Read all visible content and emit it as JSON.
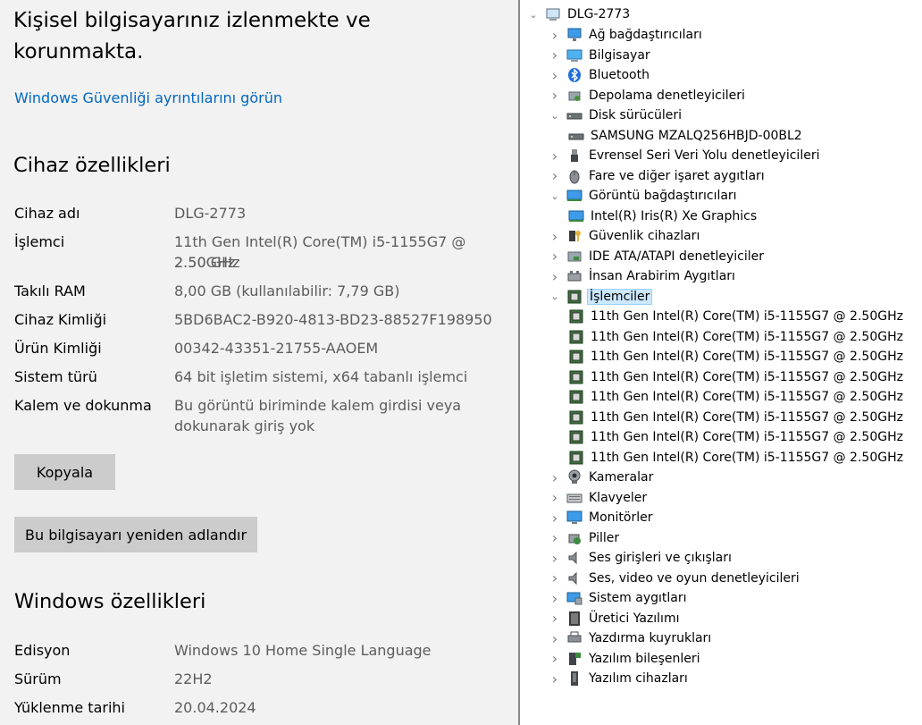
{
  "about": {
    "header": "Kişisel bilgisayarınız izlenmekte ve korunmakta.",
    "security_link": "Windows Güvenliği ayrıntılarını görün",
    "device_specs_title": "Cihaz özellikleri",
    "device_specs": [
      {
        "label": "Cihaz adı",
        "value": "DLG-2773"
      },
      {
        "label": "İşlemci",
        "value": "11th Gen Intel(R) Core(TM) i5-1155G7 @ 2.50GHz",
        "value2": "2.50 GHz"
      },
      {
        "label": "Takılı RAM",
        "value": "8,00 GB (kullanılabilir: 7,79 GB)"
      },
      {
        "label": "Cihaz Kimliği",
        "value": "5BD6BAC2-B920-4813-BD23-88527F198950"
      },
      {
        "label": "Ürün Kimliği",
        "value": "00342-43351-21755-AAOEM"
      },
      {
        "label": "Sistem türü",
        "value": "64 bit işletim sistemi, x64 tabanlı işlemci"
      },
      {
        "label": "Kalem ve dokunma",
        "value": "Bu görüntü biriminde kalem girdisi veya",
        "value2": "dokunarak giriş yok"
      }
    ],
    "copy_button": "Kopyala",
    "rename_button": "Bu bilgisayarı yeniden adlandır",
    "windows_specs_title": "Windows özellikleri",
    "windows_specs": [
      {
        "label": "Edisyon",
        "value": "Windows 10 Home Single Language"
      },
      {
        "label": "Sürüm",
        "value": "22H2"
      },
      {
        "label": "Yüklenme tarihi",
        "value": "20.04.2024"
      }
    ]
  },
  "device_manager": {
    "root": "DLG-2773",
    "items": [
      {
        "label": "Ağ bağdaştırıcıları",
        "icon": "network-adapter-icon",
        "expanded": false
      },
      {
        "label": "Bilgisayar",
        "icon": "computer-icon",
        "expanded": false
      },
      {
        "label": "Bluetooth",
        "icon": "bluetooth-icon",
        "expanded": false
      },
      {
        "label": "Depolama denetleyicileri",
        "icon": "storage-controller-icon",
        "expanded": false
      },
      {
        "label": "Disk sürücüleri",
        "icon": "disk-drive-icon",
        "expanded": true
      },
      {
        "label": "SAMSUNG MZALQ256HBJD-00BL2",
        "icon": "disk-drive-icon",
        "child": true
      },
      {
        "label": "Evrensel Seri Veri Yolu denetleyicileri",
        "icon": "usb-icon",
        "expanded": false
      },
      {
        "label": "Fare ve diğer işaret aygıtları",
        "icon": "mouse-icon",
        "expanded": false
      },
      {
        "label": "Görüntü bağdaştırıcıları",
        "icon": "display-adapter-icon",
        "expanded": true
      },
      {
        "label": "Intel(R) Iris(R) Xe Graphics",
        "icon": "display-adapter-icon",
        "child": true
      },
      {
        "label": "Güvenlik cihazları",
        "icon": "security-device-icon",
        "expanded": false
      },
      {
        "label": "IDE ATA/ATAPI denetleyiciler",
        "icon": "ide-controller-icon",
        "expanded": false
      },
      {
        "label": "İnsan Arabirim Aygıtları",
        "icon": "hid-icon",
        "expanded": false
      },
      {
        "label": "İşlemciler",
        "icon": "processor-icon",
        "expanded": true,
        "selected": true
      },
      {
        "label": "11th Gen Intel(R) Core(TM) i5-1155G7 @ 2.50GHz",
        "icon": "processor-icon",
        "child": true
      },
      {
        "label": "11th Gen Intel(R) Core(TM) i5-1155G7 @ 2.50GHz",
        "icon": "processor-icon",
        "child": true
      },
      {
        "label": "11th Gen Intel(R) Core(TM) i5-1155G7 @ 2.50GHz",
        "icon": "processor-icon",
        "child": true
      },
      {
        "label": "11th Gen Intel(R) Core(TM) i5-1155G7 @ 2.50GHz",
        "icon": "processor-icon",
        "child": true
      },
      {
        "label": "11th Gen Intel(R) Core(TM) i5-1155G7 @ 2.50GHz",
        "icon": "processor-icon",
        "child": true
      },
      {
        "label": "11th Gen Intel(R) Core(TM) i5-1155G7 @ 2.50GHz",
        "icon": "processor-icon",
        "child": true
      },
      {
        "label": "11th Gen Intel(R) Core(TM) i5-1155G7 @ 2.50GHz",
        "icon": "processor-icon",
        "child": true
      },
      {
        "label": "11th Gen Intel(R) Core(TM) i5-1155G7 @ 2.50GHz",
        "icon": "processor-icon",
        "child": true
      },
      {
        "label": "Kameralar",
        "icon": "camera-icon",
        "expanded": false
      },
      {
        "label": "Klavyeler",
        "icon": "keyboard-icon",
        "expanded": false
      },
      {
        "label": "Monitörler",
        "icon": "monitor-icon",
        "expanded": false
      },
      {
        "label": "Piller",
        "icon": "battery-icon",
        "expanded": false
      },
      {
        "label": "Ses girişleri ve çıkışları",
        "icon": "speaker-icon",
        "expanded": false
      },
      {
        "label": "Ses, video ve oyun denetleyicileri",
        "icon": "speaker-icon",
        "expanded": false
      },
      {
        "label": "Sistem aygıtları",
        "icon": "system-device-icon",
        "expanded": false
      },
      {
        "label": "Üretici Yazılımı",
        "icon": "firmware-icon",
        "expanded": false
      },
      {
        "label": "Yazdırma kuyrukları",
        "icon": "printer-icon",
        "expanded": false
      },
      {
        "label": "Yazılım bileşenleri",
        "icon": "software-component-icon",
        "expanded": false
      },
      {
        "label": "Yazılım cihazları",
        "icon": "software-device-icon",
        "expanded": false
      }
    ]
  }
}
